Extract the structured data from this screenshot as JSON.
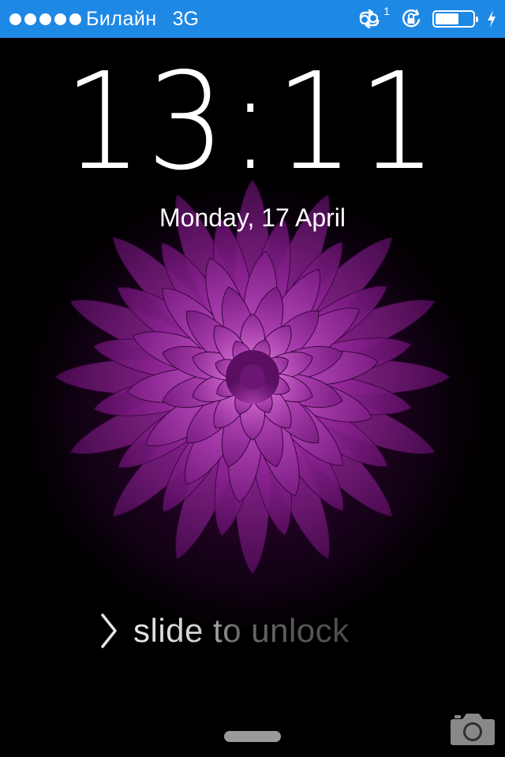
{
  "status_bar": {
    "signal_bars": 5,
    "carrier": "Билайн",
    "network": "3G",
    "sync_count": "1",
    "battery_level": 0.62,
    "accent_color": "#1e88e5",
    "icons": [
      "signal-dots-icon",
      "sync-icon",
      "rotation-lock-icon",
      "battery-icon",
      "charging-bolt-icon"
    ]
  },
  "lock_screen": {
    "time": "13:11",
    "date": "Monday, 17 April",
    "unlock_label": "slide to unlock",
    "wallpaper": "purple-dahlia-flower",
    "camera_icon": "camera-icon"
  }
}
